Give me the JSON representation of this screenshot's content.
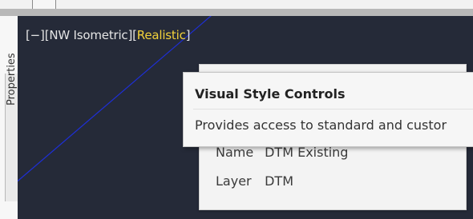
{
  "viewport": {
    "controls_minus": "[−]",
    "controls_view": "[NW Isometric]",
    "controls_style_open": "[",
    "controls_style": "Realistic",
    "controls_style_close": "]"
  },
  "left_palette": {
    "tab_label": "Properties"
  },
  "properties_card": {
    "rows": [
      {
        "key": "Name",
        "value": "DTM Existing"
      },
      {
        "key": "Layer",
        "value": "DTM"
      }
    ]
  },
  "tooltip": {
    "title": "Visual Style Controls",
    "description": "Provides access to standard and custor"
  },
  "colors": {
    "viewport_bg": "#252a38",
    "style_highlight": "#f2d23a",
    "blue_line": "#1e2fd6"
  }
}
